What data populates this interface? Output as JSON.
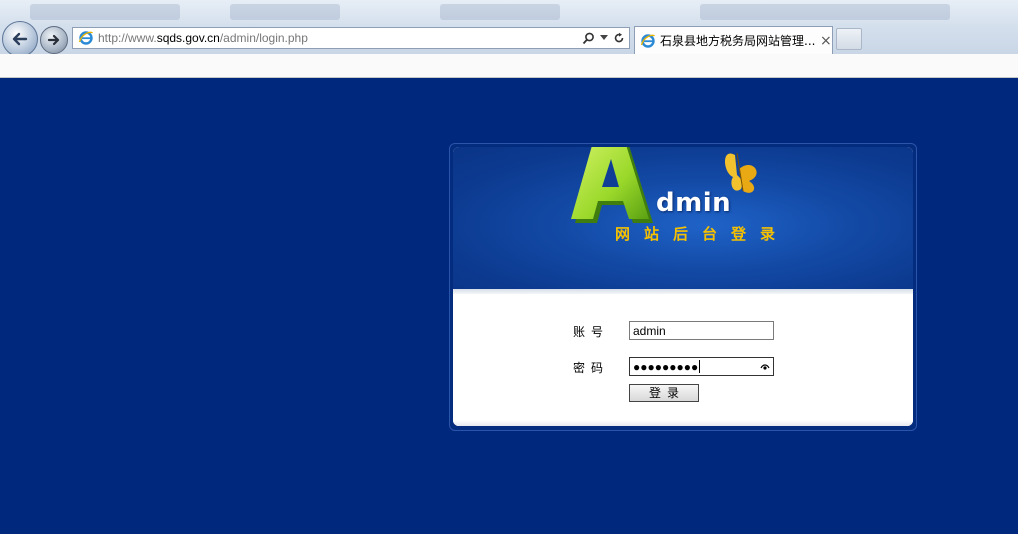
{
  "browser": {
    "url_prefix": "http://www.",
    "url_host": "sqds.gov.cn",
    "url_path": "/admin/login.php",
    "tab_title": "石泉县地方税务局网站管理...",
    "tab_close": "×"
  },
  "login": {
    "logo_letter": "A",
    "logo_word": "dmin",
    "subtitle": "网站后台登录",
    "account_label": "账号",
    "account_value": "admin",
    "password_label": "密码",
    "password_dots": "●●●●●●●●●",
    "submit_label": "登录"
  },
  "colors": {
    "page_background": "#00287d",
    "subtitle": "#f5c000",
    "logo_green": "#9ad82a"
  }
}
